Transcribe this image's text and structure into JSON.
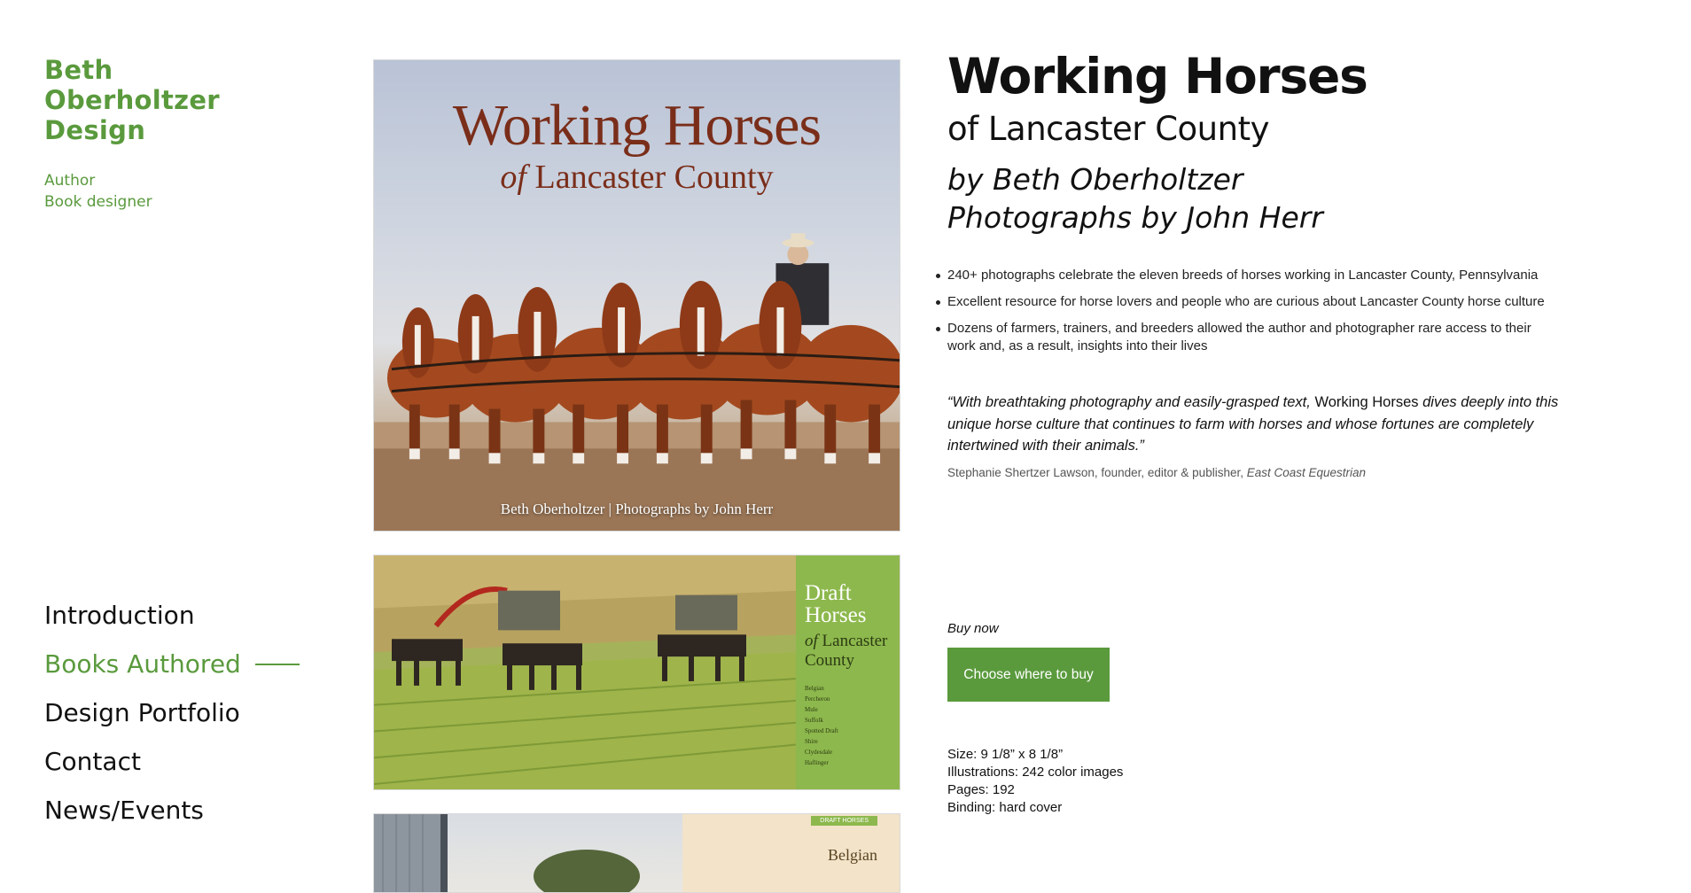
{
  "brand": {
    "line1": "Beth",
    "line2": "Oberholtzer",
    "line3": "Design",
    "role1": "Author",
    "role2": "Book designer",
    "accent_color": "#5a9a3d"
  },
  "nav": {
    "items": [
      {
        "label": "Introduction",
        "active": false
      },
      {
        "label": "Books Authored",
        "active": true
      },
      {
        "label": "Design Portfolio",
        "active": false
      },
      {
        "label": "Contact",
        "active": false
      },
      {
        "label": "News/Events",
        "active": false
      }
    ]
  },
  "cover": {
    "title": "Working Horses",
    "subtitle_of": "of",
    "subtitle_rest": " Lancaster County",
    "byline": "Beth Oberholtzer | Photographs by John Herr"
  },
  "spread1": {
    "title_line1": "Draft",
    "title_line2": "Horses",
    "sub_of": "of",
    "sub_rest": " Lancaster",
    "sub_line2": "County",
    "breeds": [
      "Belgian",
      "Percheron",
      "Mule",
      "Suffolk",
      "Spotted Draft",
      "Shire",
      "Clydesdale",
      "Haflinger"
    ]
  },
  "spread2": {
    "tag": "DRAFT HORSES",
    "title": "Belgian"
  },
  "book": {
    "title": "Working Horses",
    "subtitle": "of Lancaster County",
    "author": "by Beth Oberholtzer",
    "photographer": "Photographs by John Herr",
    "bullets": [
      "240+ photographs celebrate the eleven breeds of horses working in Lancaster County, Pennsylvania",
      "Excellent resource for horse lovers and people who are curious about Lancaster County horse culture",
      "Dozens of farmers, trainers, and breeders allowed the author and photographer rare access to their work and, as a result, insights into their lives"
    ],
    "quote_part1": "“With breathtaking photography and easily-grasped text, ",
    "quote_part2": "Working Horses",
    "quote_part3": " dives deeply into this unique horse culture that continues to farm with horses and whose fortunes are completely intertwined with their animals.”",
    "attribution": "Stephanie Shertzer Lawson, founder, editor & publisher, ",
    "attribution_pub": "East Coast Equestrian",
    "buy_label": "Buy now",
    "buy_button": "Choose where to buy",
    "specs": {
      "size": "Size: 9 1/8” x 8 1/8”",
      "illustrations": "Illustrations: 242 color images",
      "pages": "Pages: 192",
      "binding": "Binding: hard cover"
    }
  }
}
